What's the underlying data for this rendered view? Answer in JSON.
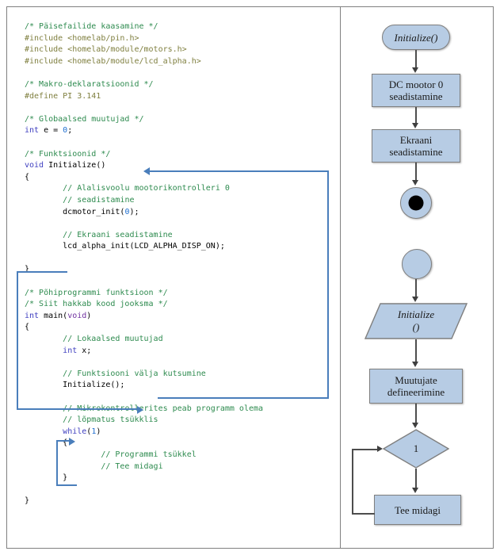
{
  "code": {
    "language": "c",
    "lines": [
      [
        {
          "t": "/* Päisefailide kaasamine */",
          "c": "cm"
        }
      ],
      [
        {
          "t": "#include <homelab/pin.h>",
          "c": "pp"
        }
      ],
      [
        {
          "t": "#include <homelab/module/motors.h>",
          "c": "pp"
        }
      ],
      [
        {
          "t": "#include <homelab/module/lcd_alpha.h>",
          "c": "pp"
        }
      ],
      [
        {
          "t": "",
          "c": "pl"
        }
      ],
      [
        {
          "t": "/* Makro-deklaratsioonid */",
          "c": "cm"
        }
      ],
      [
        {
          "t": "#define PI 3.141",
          "c": "pp"
        }
      ],
      [
        {
          "t": "",
          "c": "pl"
        }
      ],
      [
        {
          "t": "/* Globaalsed muutujad */",
          "c": "cm"
        }
      ],
      [
        {
          "t": "int",
          "c": "kw"
        },
        {
          "t": " e = ",
          "c": "pl"
        },
        {
          "t": "0",
          "c": "num"
        },
        {
          "t": ";",
          "c": "pl"
        }
      ],
      [
        {
          "t": "",
          "c": "pl"
        }
      ],
      [
        {
          "t": "/* Funktsioonid */",
          "c": "cm"
        }
      ],
      [
        {
          "t": "void",
          "c": "kw"
        },
        {
          "t": " Initialize()",
          "c": "pl"
        }
      ],
      [
        {
          "t": "{",
          "c": "pl"
        }
      ],
      [
        {
          "t": "        ",
          "c": "pl"
        },
        {
          "t": "// Alalisvoolu mootorikontrolleri 0",
          "c": "cm"
        }
      ],
      [
        {
          "t": "        ",
          "c": "pl"
        },
        {
          "t": "// seadistamine",
          "c": "cm"
        }
      ],
      [
        {
          "t": "        dcmotor_init(",
          "c": "pl"
        },
        {
          "t": "0",
          "c": "num"
        },
        {
          "t": ");",
          "c": "pl"
        }
      ],
      [
        {
          "t": "",
          "c": "pl"
        }
      ],
      [
        {
          "t": "        ",
          "c": "pl"
        },
        {
          "t": "// Ekraani seadistamine",
          "c": "cm"
        }
      ],
      [
        {
          "t": "        lcd_alpha_init(LCD_ALPHA_DISP_ON);",
          "c": "pl"
        }
      ],
      [
        {
          "t": "",
          "c": "pl"
        }
      ],
      [
        {
          "t": "}",
          "c": "pl"
        }
      ],
      [
        {
          "t": "",
          "c": "pl"
        }
      ],
      [
        {
          "t": "/* Põhiprogrammi funktsioon */",
          "c": "cm"
        }
      ],
      [
        {
          "t": "/* Siit hakkab kood jooksma */",
          "c": "cm"
        }
      ],
      [
        {
          "t": "int",
          "c": "kw"
        },
        {
          "t": " main(",
          "c": "pl"
        },
        {
          "t": "void",
          "c": "kw2"
        },
        {
          "t": ")",
          "c": "pl"
        }
      ],
      [
        {
          "t": "{",
          "c": "pl"
        }
      ],
      [
        {
          "t": "        ",
          "c": "pl"
        },
        {
          "t": "// Lokaalsed muutujad",
          "c": "cm"
        }
      ],
      [
        {
          "t": "        ",
          "c": "pl"
        },
        {
          "t": "int",
          "c": "kw"
        },
        {
          "t": " x;",
          "c": "pl"
        }
      ],
      [
        {
          "t": "",
          "c": "pl"
        }
      ],
      [
        {
          "t": "        ",
          "c": "pl"
        },
        {
          "t": "// Funktsiooni välja kutsumine",
          "c": "cm"
        }
      ],
      [
        {
          "t": "        Initialize();",
          "c": "pl"
        }
      ],
      [
        {
          "t": "",
          "c": "pl"
        }
      ],
      [
        {
          "t": "        ",
          "c": "pl"
        },
        {
          "t": "// Mikrokontrollerites peab programm olema",
          "c": "cm"
        }
      ],
      [
        {
          "t": "        ",
          "c": "pl"
        },
        {
          "t": "// lõpmatus tsükklis",
          "c": "cm"
        }
      ],
      [
        {
          "t": "        ",
          "c": "pl"
        },
        {
          "t": "while",
          "c": "kw"
        },
        {
          "t": "(",
          "c": "pl"
        },
        {
          "t": "1",
          "c": "num"
        },
        {
          "t": ")",
          "c": "pl"
        }
      ],
      [
        {
          "t": "        {",
          "c": "pl"
        }
      ],
      [
        {
          "t": "                ",
          "c": "pl"
        },
        {
          "t": "// Programmi tsükkel",
          "c": "cm"
        }
      ],
      [
        {
          "t": "                ",
          "c": "pl"
        },
        {
          "t": "// Tee midagi",
          "c": "cm"
        }
      ],
      [
        {
          "t": "        }",
          "c": "pl"
        }
      ],
      [
        {
          "t": "",
          "c": "pl"
        }
      ],
      [
        {
          "t": "}",
          "c": "pl"
        }
      ]
    ]
  },
  "annotations": {
    "arrow_color": "#4a7ebb",
    "call_arrow_label": "Initialize() call jumps to void Initialize()",
    "return_arrow_label": "return from Initialize() back into main",
    "loop_arrow_label": "while(1) infinite loop back edge"
  },
  "flowchart": {
    "shape_fill": "#b7cce4",
    "shape_border": "#7f7f7f",
    "connector_color": "#4d4d4d",
    "nodes": [
      {
        "id": "init-terminator",
        "type": "terminator",
        "label": "Initialize()"
      },
      {
        "id": "dc-motor",
        "type": "process",
        "label": "DC mootor 0\nseadistamine",
        "line1": "DC mootor 0",
        "line2": "seadistamine"
      },
      {
        "id": "screen",
        "type": "process",
        "label": "Ekraani\nseadistamine",
        "line1": "Ekraani",
        "line2": "seadistamine"
      },
      {
        "id": "end-node",
        "type": "end",
        "label": ""
      },
      {
        "id": "start-node",
        "type": "start",
        "label": ""
      },
      {
        "id": "call-initialize",
        "type": "parallelogram",
        "line1": "Initialize",
        "line2": "()"
      },
      {
        "id": "define-vars",
        "type": "process",
        "line1": "Muutujate",
        "line2": "defineerimine"
      },
      {
        "id": "condition",
        "type": "decision",
        "label": "1"
      },
      {
        "id": "do-something",
        "type": "process",
        "label": "Tee midagi"
      }
    ]
  }
}
